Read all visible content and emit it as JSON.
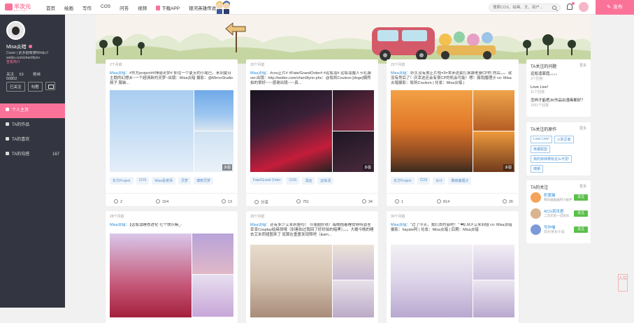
{
  "topbar": {
    "logo_text": "半次元",
    "logo_sub": "BCY.NET",
    "nav": [
      "首页",
      "绘画",
      "写作",
      "COS",
      "问答",
      "视频",
      "下载APP",
      "银河英雄传说"
    ],
    "search_placeholder": "搜索COS、绘画、文、用户...",
    "publish_label": "发布"
  },
  "profile": {
    "name": "Misa炎暗",
    "bio_line1": "Coser | 更多戳微博呀http://",
    "bio_line2": "weibo.com/zhen9lynn",
    "bio_more": "查看简介",
    "follows_label": "关注",
    "follows_value": "53",
    "fans_label": "粉丝",
    "fans_value": "50802",
    "followed_label": "已关注",
    "private_msg_label": "勾搭"
  },
  "menu": [
    {
      "label": "个人主页",
      "count": "",
      "active": true
    },
    {
      "label": "TA的作品",
      "count": "",
      "active": false
    },
    {
      "label": "TA的喜欢",
      "count": "",
      "active": false
    },
    {
      "label": "TA的勾搭",
      "count": "167",
      "active": false
    }
  ],
  "posts": [
    {
      "time": "2个月前",
      "author": "Misa炎暗：",
      "text": "#东方project##博丽灵梦# 抓住一个夏天的小尾巴，来到夏日主题的幻想乡~一个超清新的灵梦~出镜：Misa炎暗 摄影：@MirrorStudio瓶子 服装...",
      "more_imgs": "多图",
      "tags": [
        "东方Project",
        "COS",
        "Misa看老师",
        "灵梦",
        "博丽灵梦"
      ],
      "shares": "2",
      "likes": "164",
      "comments": "13"
    },
    {
      "time": "20个月前",
      "author": "Misa炎暗：",
      "text": "#cos正片# #Fate/GrandOrder# #远坂凛# 远坂凛魔人节礼服ver.出镜：http://weibo.com/zhen9lynn phx：@坂凯Coulson [doge]偶然拍的很好~~~感谢出镜~~~真...",
      "more_imgs": "多图",
      "tags": [
        "Fate/Grand Order",
        "COS",
        "凛远",
        "远坂凛"
      ],
      "shares": "分享",
      "likes": "751",
      "comments": "34"
    },
    {
      "time": "23个月前",
      "author": "Misa炎暗：",
      "text": "好久没有放正片啦=3=本来这套打算跟老婆CP的 然后。。。就没有然后了！庆幸这还会有很CP的机会可能！嗯！霧雨魔理沙 cn: Misa炎暗摄影：坂凯Coulson | 化妆：Misa炎暗 |",
      "more_imgs": "多图",
      "tags": [
        "东方Project",
        "COS",
        "女仆",
        "霧雨魔理沙"
      ],
      "shares": "1",
      "likes": "814",
      "comments": "26"
    },
    {
      "time": "28个月前",
      "author": "Misa炎暗：",
      "text": "【远坂凛睡衣进化 七个快乐嘛_-"
    },
    {
      "time": "28个月前",
      "author": "Misa炎暗：",
      "text": "还有多少艾米莉娅吗！ 斗篷超好哒！每晚抱着睡觉呀呀@圭幸幸Cosplay给麻烦哦（别害拍过我回了好好拍的暗黑）。。。大概今晚的睡衣艾米莉娅图来了 就算在重置发现照吧（&am..."
    },
    {
      "time": "30个月前",
      "author": "Misa炎暗：",
      "text": "“过了今天，我们去约会吧！” ❤E.M.F艾米莉娅 cn: Misa炎暗摄影：hayate阿 | 化妆：Misa炎暗 | 后期：Misa炎暗"
    }
  ],
  "right": {
    "q_title": "TA关注的问题",
    "q_more": "更多",
    "questions": [
      {
        "title": "远坂凛家庭。。。。",
        "sub": "3个回答"
      },
      {
        "title": "Love Live!",
        "sub": "11个回答"
      },
      {
        "title": "怎样才能把JK作品出漫画都好？",
        "sub": "1001个回答"
      }
    ],
    "w_title": "TA关注的原作",
    "w_more": "更多",
    "works": [
      "Love Live!",
      "火影忍者",
      "英雄联盟",
      "我的妹妹哪有这么可爱!",
      "珊娜"
    ],
    "u_title": "TA的关注",
    "u_more": "更多",
    "users": [
      {
        "name": "奶黄猫",
        "desc": "每日画画画的小画手",
        "btn": "关注"
      },
      {
        "name": "ACG资讯君",
        "desc": "二次元的一切资讯",
        "btn": "关注"
      },
      {
        "name": "写作喵",
        "desc": "日文/英文/小说",
        "btn": "关注"
      }
    ]
  },
  "stamp": "入坑",
  "colors": {
    "accent": "#fb7299",
    "link": "#2c8bd6",
    "follow": "#5bbf4b",
    "sidebar": "#333640"
  }
}
